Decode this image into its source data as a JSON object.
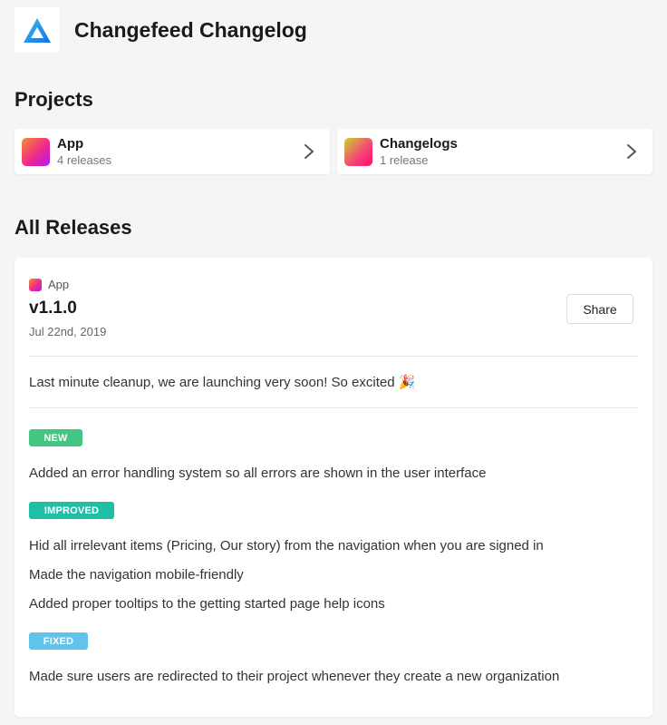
{
  "app": {
    "title": "Changefeed Changelog",
    "logo_icon": "triangle-logo-icon"
  },
  "projects": {
    "heading": "Projects",
    "items": [
      {
        "name": "App",
        "count": "4 releases"
      },
      {
        "name": "Changelogs",
        "count": "1 release"
      }
    ]
  },
  "releases": {
    "heading": "All Releases",
    "release": {
      "project": "App",
      "version": "v1.1.0",
      "date": "Jul 22nd, 2019",
      "share_label": "Share",
      "summary": "Last minute cleanup, we are launching very soon! So excited 🎉",
      "groups": [
        {
          "badge": "NEW",
          "items": [
            "Added an error handling system so all errors are shown in the user interface"
          ]
        },
        {
          "badge": "IMPROVED",
          "items": [
            "Hid all irrelevant items (Pricing, Our story) from the navigation when you are signed in",
            "Made the navigation mobile-friendly",
            "Added proper tooltips to the getting started page help icons"
          ]
        },
        {
          "badge": "FIXED",
          "items": [
            "Made sure users are redirected to their project whenever they create a new organization"
          ]
        }
      ]
    }
  },
  "colors": {
    "background": "#f4f5f7",
    "new": "#44c583",
    "improved": "#1fbfa6",
    "fixed": "#5fc3ec"
  }
}
